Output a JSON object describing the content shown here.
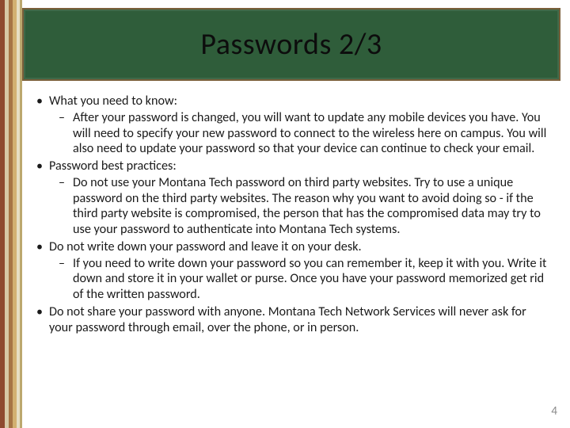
{
  "title": "Passwords 2/3",
  "page_number": "4",
  "bullets": {
    "b0": {
      "text": "What you need to know:",
      "sub": "After your password is changed, you will want to update any mobile devices you have.  You will need to specify your new password to connect to the wireless here on campus.  You will also need to update your password so that your device can continue to check your email."
    },
    "b1": {
      "text": "Password best practices:",
      "sub": "Do not use your Montana Tech password on third party websites.  Try to use a unique password on the third party websites.  The reason why you want to avoid doing so - if the third party website is compromised, the person that has the compromised data may try to use your password to authenticate into Montana Tech systems."
    },
    "b2": {
      "text": "Do not write down your password and leave it on your desk.",
      "sub": "If you need to write down your password so you can remember it, keep it with you.  Write it down and store it in your wallet or purse.  Once you have your password memorized get rid of the written password."
    },
    "b3": {
      "text": "Do not share your password with anyone.  Montana Tech Network Services will never ask for your password through email, over the phone, or in person."
    }
  }
}
